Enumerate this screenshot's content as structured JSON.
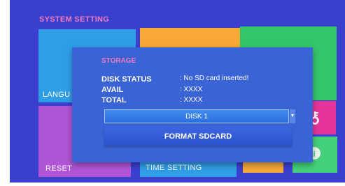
{
  "screen": {
    "title": "SYSTEM SETTING"
  },
  "tiles": {
    "language_label": "LANGU",
    "reset_label": "RESET",
    "time_setting_label": "TIME SETTING",
    "key_icon": "key-icon",
    "info_icon": "info-icon"
  },
  "dialog": {
    "title": "STORAGE",
    "rows": [
      {
        "label": "DISK STATUS",
        "value": ": No SD card inserted!"
      },
      {
        "label": "AVAIL",
        "value": ": XXXX"
      },
      {
        "label": "TOTAL",
        "value": ": XXXX"
      }
    ],
    "disk_select_value": "DISK 1",
    "format_button_label": "FORMAT SDCARD"
  },
  "colors": {
    "background": "#3a3fd0",
    "tile_blue": "#2f9ee6",
    "tile_orange": "#f7a836",
    "tile_green": "#34c46a",
    "tile_purple": "#b055d6",
    "tile_pink": "#e7349a",
    "tile_light_green": "#44d07a",
    "accent_pink": "#f07bbf"
  }
}
